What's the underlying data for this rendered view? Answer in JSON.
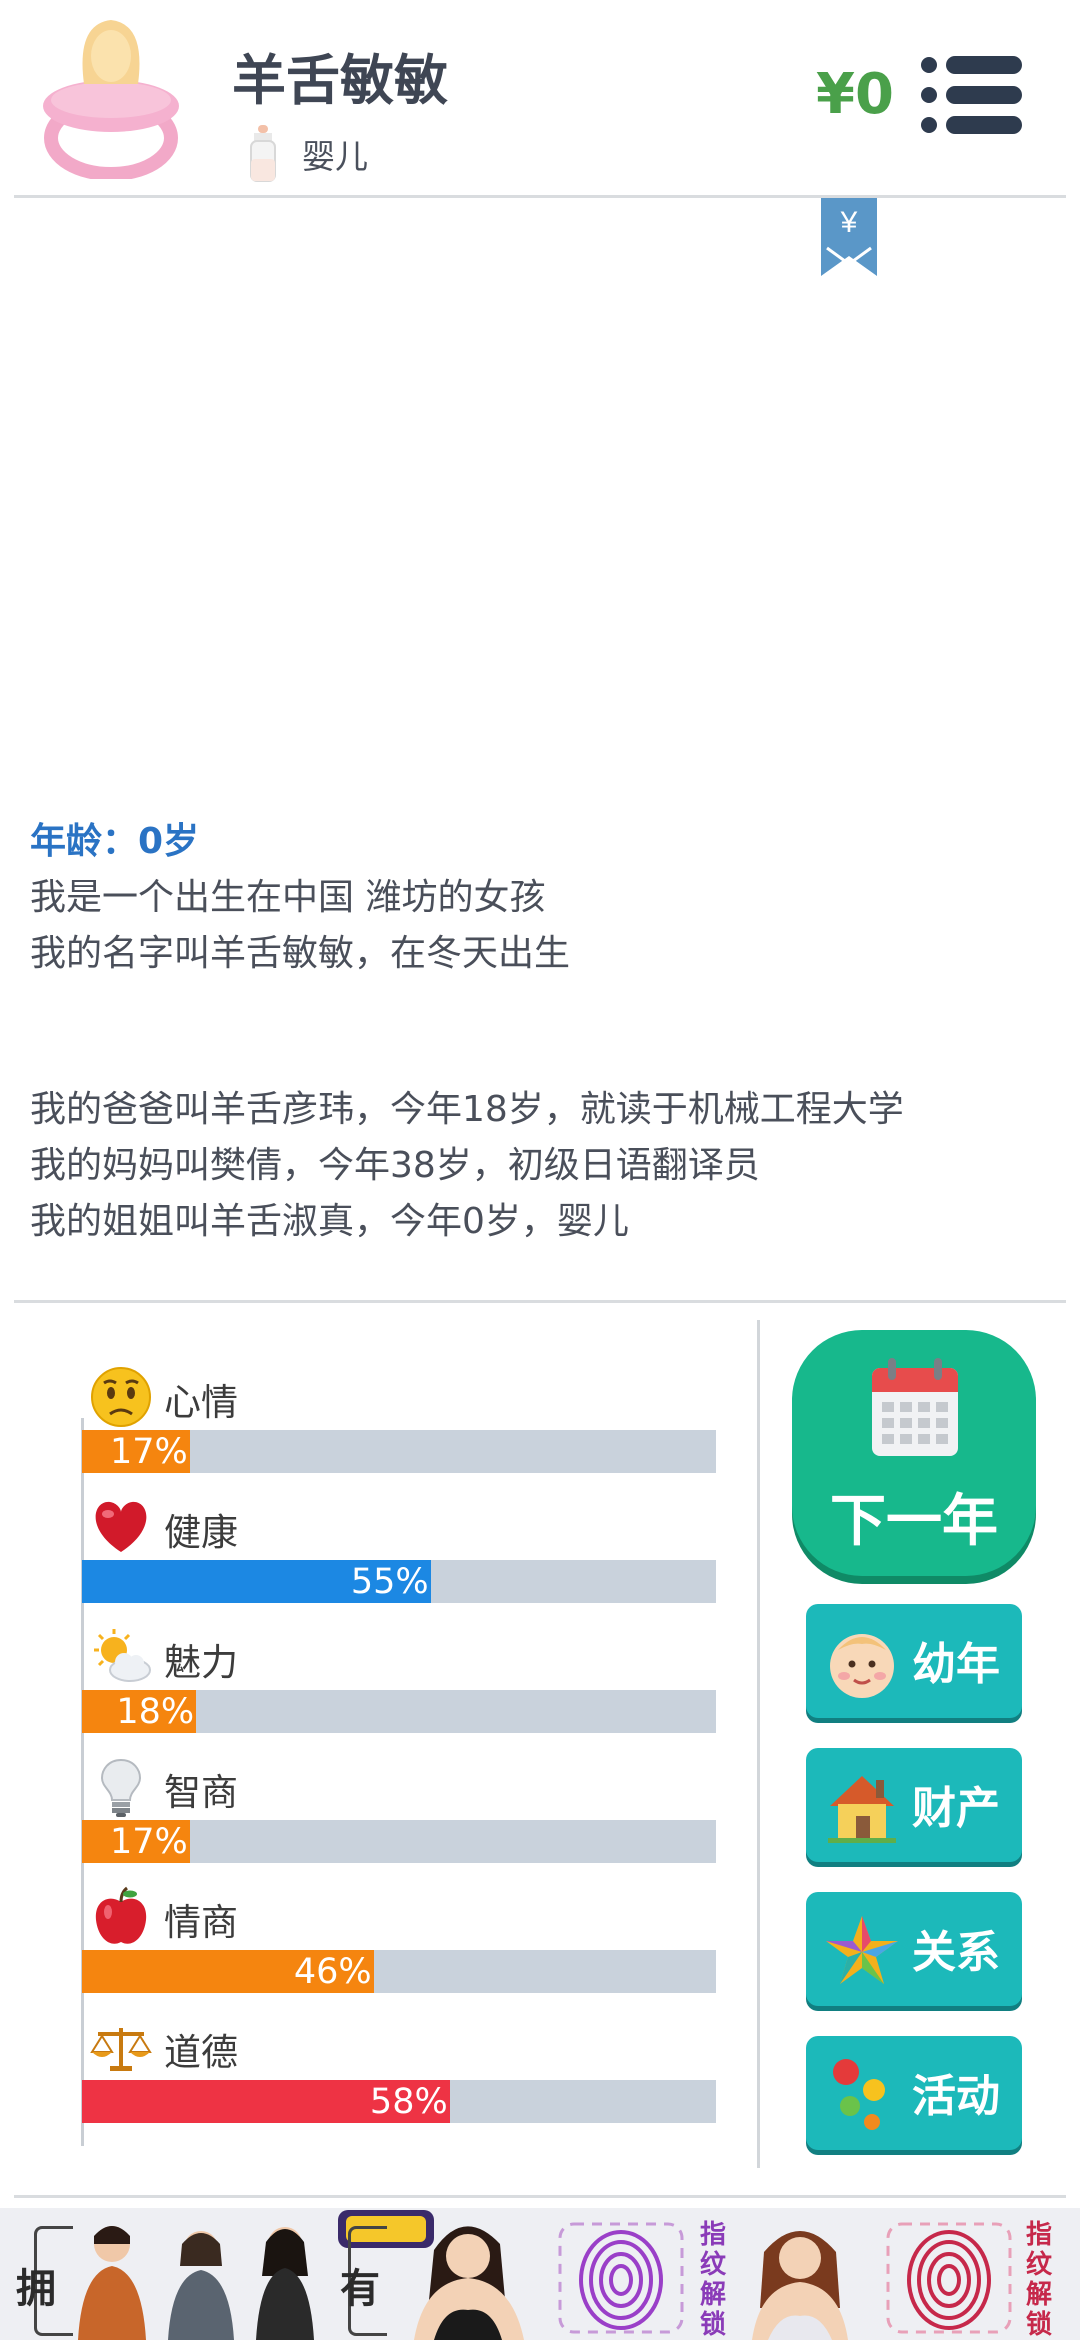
{
  "header": {
    "name": "羊舌敏敏",
    "stage_label": "婴儿",
    "money": "¥0",
    "ribbon_symbol": "¥"
  },
  "story": {
    "age_line": "年龄：0岁",
    "lines_a": [
      "我是一个出生在中国 潍坊的女孩",
      "我的名字叫羊舌敏敏，在冬天出生"
    ],
    "lines_b": [
      "我的爸爸叫羊舌彦玮，今年18岁，就读于机械工程大学",
      "我的妈妈叫樊倩，今年38岁，初级日语翻译员",
      "我的姐姐叫羊舌淑真，今年0岁，婴儿"
    ]
  },
  "stats": [
    {
      "label": "心情",
      "value": 17,
      "pct": "17%",
      "color": "#f5850f",
      "icon": "sad-face-icon"
    },
    {
      "label": "健康",
      "value": 55,
      "pct": "55%",
      "color": "#1c88e3",
      "icon": "heart-icon"
    },
    {
      "label": "魅力",
      "value": 18,
      "pct": "18%",
      "color": "#f5850f",
      "icon": "sun-cloud-icon"
    },
    {
      "label": "智商",
      "value": 17,
      "pct": "17%",
      "color": "#f5850f",
      "icon": "lightbulb-icon"
    },
    {
      "label": "情商",
      "value": 46,
      "pct": "46%",
      "color": "#f5850f",
      "icon": "apple-icon"
    },
    {
      "label": "道德",
      "value": 58,
      "pct": "58%",
      "color": "#ee3344",
      "icon": "scales-icon"
    }
  ],
  "buttons": {
    "next_year": "下一年",
    "childhood": "幼年",
    "assets": "财产",
    "relations": "关系",
    "activities": "活动"
  },
  "ad": {
    "char1": "拥",
    "char2": "有",
    "fingerprint_text": "指纹解锁",
    "fingerprint_text2": "指纹解锁"
  },
  "colors": {
    "accent_green": "#17b88c",
    "side_button": "#1cb9ba",
    "money_green": "#4aa04a",
    "age_blue": "#2a73c4"
  }
}
